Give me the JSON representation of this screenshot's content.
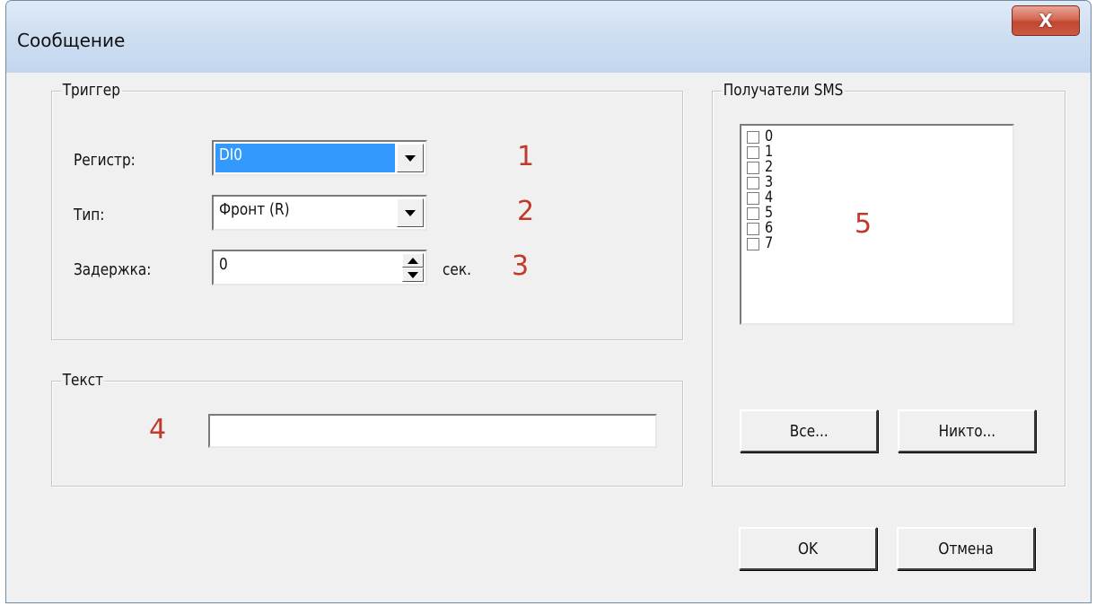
{
  "window": {
    "title": "Сообщение",
    "close_glyph": "X"
  },
  "trigger_group": {
    "legend": "Триггер",
    "register_label": "Регистр:",
    "register_value": "DI0",
    "type_label": "Тип:",
    "type_value": "Фронт (R)",
    "delay_label": "Задержка:",
    "delay_value": "0",
    "delay_unit": "сек."
  },
  "text_group": {
    "legend": "Текст",
    "text_value": ""
  },
  "sms_group": {
    "legend": "Получатели SMS",
    "recipients": [
      "0",
      "1",
      "2",
      "3",
      "4",
      "5",
      "6",
      "7"
    ],
    "all_button": "Все...",
    "none_button": "Никто..."
  },
  "footer": {
    "ok_button": "OK",
    "cancel_button": "Отмена"
  },
  "annotations": {
    "n1": "1",
    "n2": "2",
    "n3": "3",
    "n4": "4",
    "n5": "5"
  },
  "colors": {
    "selection": "#3399ff",
    "annotation": "#c0392b",
    "close_button": "#c24630"
  }
}
